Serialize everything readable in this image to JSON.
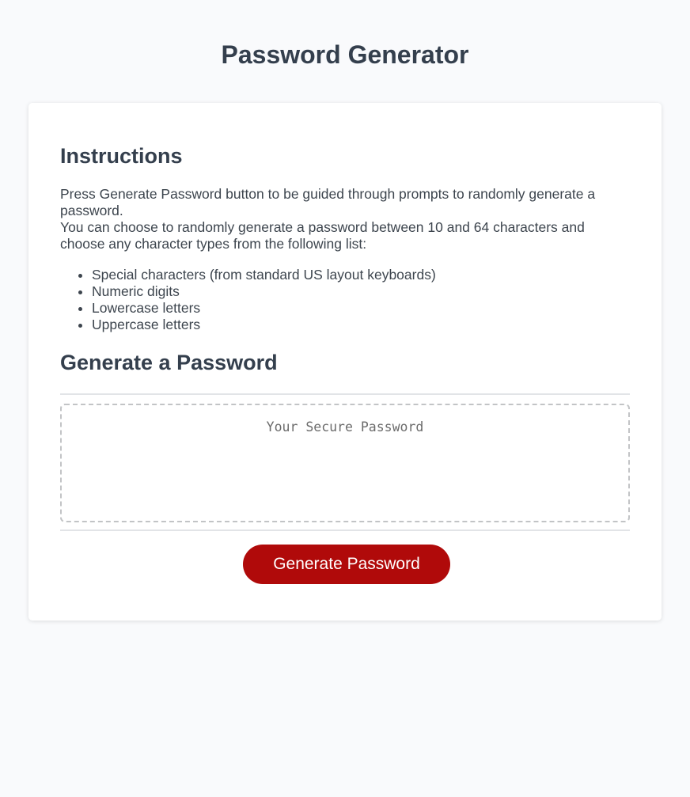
{
  "header": {
    "title": "Password Generator"
  },
  "instructions": {
    "title": "Instructions",
    "paragraph_line1": "Press Generate Password button to be guided through prompts to randomly generate a password.",
    "paragraph_line2": "You can choose to randomly generate a password between 10 and 64 characters and choose any character types from the following list:",
    "list": [
      "Special characters (from standard US layout keyboards)",
      "Numeric digits",
      "Lowercase letters",
      "Uppercase letters"
    ]
  },
  "generator": {
    "title": "Generate a Password",
    "password_value": "",
    "password_placeholder": "Your Secure Password",
    "button_label": "Generate Password"
  },
  "colors": {
    "background": "#f9fafc",
    "card": "#ffffff",
    "heading": "#343f4d",
    "button": "#b00a0a",
    "button_text": "#ffffff"
  }
}
